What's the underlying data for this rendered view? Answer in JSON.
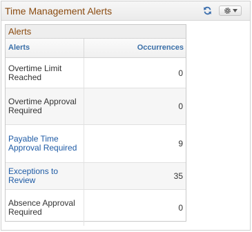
{
  "pagelet": {
    "title": "Time Management Alerts",
    "refresh_icon": "refresh-icon",
    "settings_icon": "gear-icon"
  },
  "grid": {
    "title": "Alerts",
    "columns": {
      "alerts": "Alerts",
      "occurrences": "Occurrences"
    },
    "rows": [
      {
        "alert": "Overtime Limit Reached",
        "occurrences": "0",
        "is_link": false
      },
      {
        "alert": "Overtime Approval Required",
        "occurrences": "0",
        "is_link": false
      },
      {
        "alert": "Payable Time Approval Required",
        "occurrences": "9",
        "is_link": true
      },
      {
        "alert": "Exceptions to Review",
        "occurrences": "35",
        "is_link": true
      },
      {
        "alert": "Absence Approval Required",
        "occurrences": "0",
        "is_link": false
      }
    ]
  },
  "colors": {
    "title": "#8a4a0f",
    "link": "#1d5aa5",
    "header_text": "#3a6fa8"
  }
}
